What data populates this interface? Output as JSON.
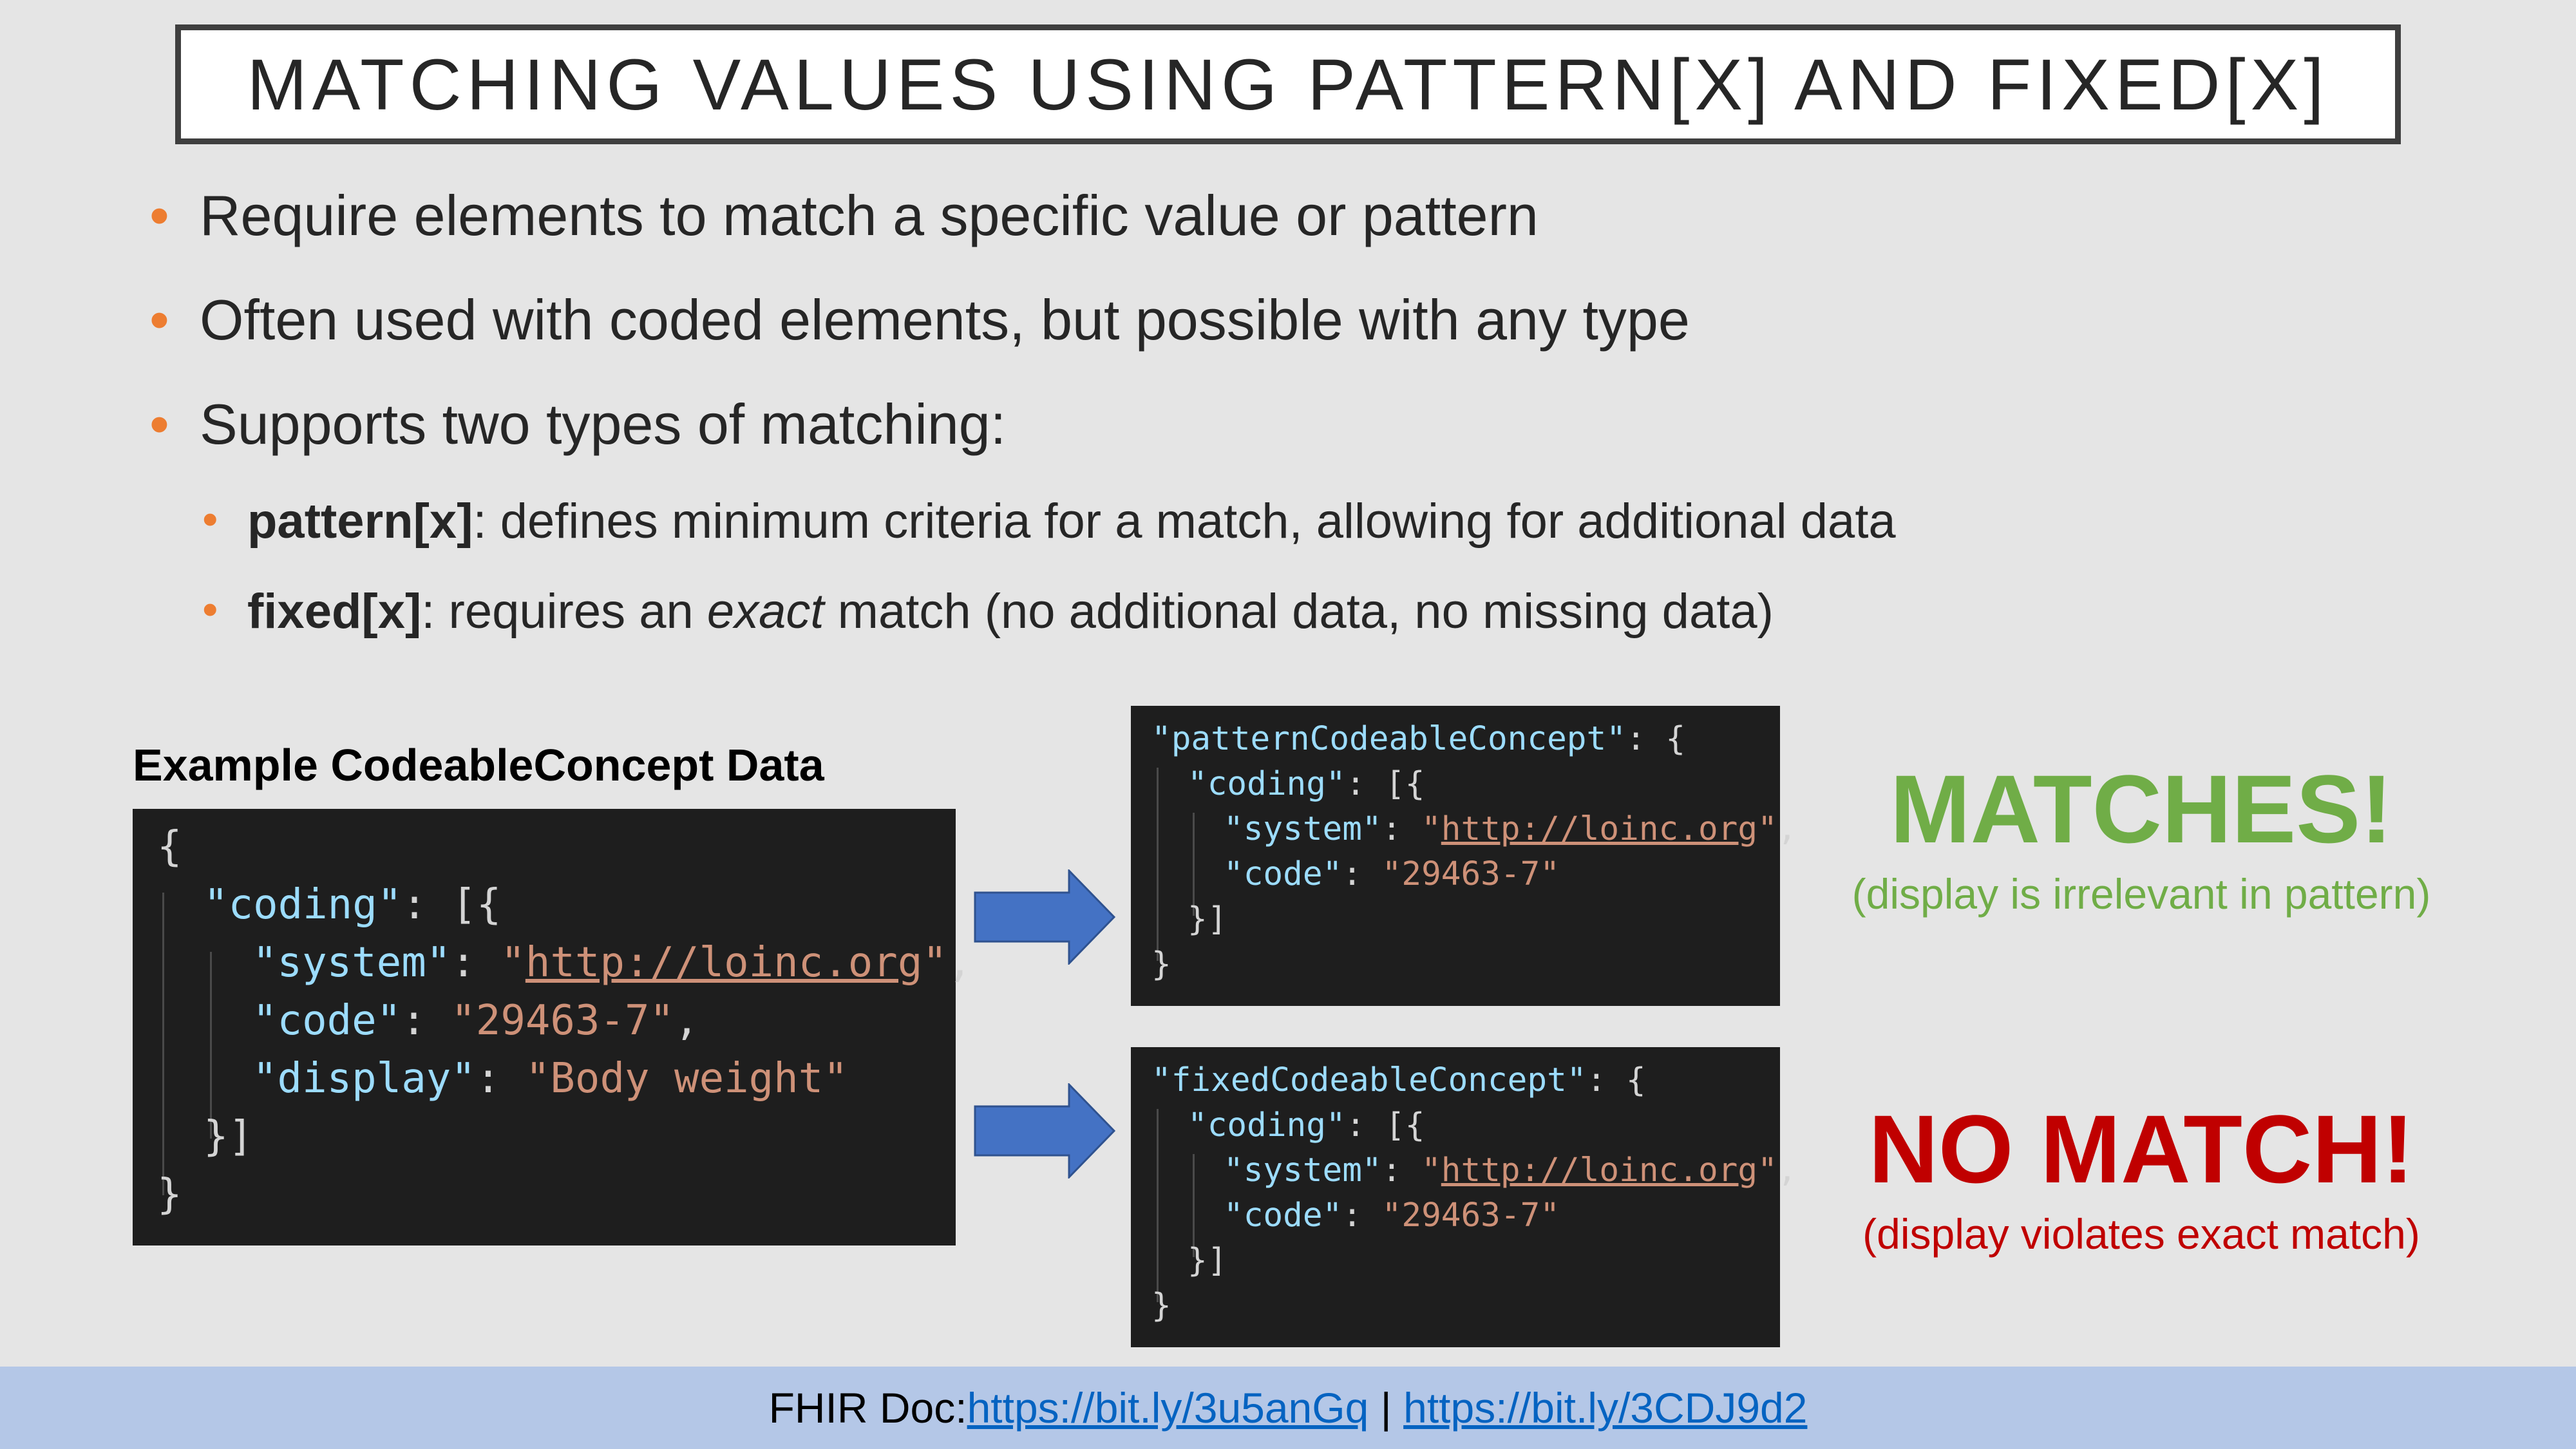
{
  "title": "MATCHING VALUES USING PATTERN[X] AND FIXED[X]",
  "bullets": {
    "b1": "Require elements to match a specific value or pattern",
    "b2": "Often used with coded elements, but possible with any type",
    "b3": "Supports two types of matching:",
    "pattern_term": "pattern[x]",
    "pattern_desc": ": defines minimum criteria for a match, allowing for additional data",
    "fixed_term": "fixed[x]",
    "fixed_desc_pre": ": requires an ",
    "fixed_desc_em": "exact",
    "fixed_desc_post": " match (no additional data, no missing data)"
  },
  "example": {
    "label": "Example CodeableConcept Data",
    "open": "{",
    "coding_key": "\"coding\"",
    "coding_open": ": [{",
    "system_key": "\"system\"",
    "colon": ": ",
    "system_q1": "\"",
    "system_url": "http://loinc.org",
    "system_q2": "\"",
    "comma": ",",
    "code_key": "\"code\"",
    "code_val": "\"29463-7\"",
    "display_key": "\"display\"",
    "display_val": "\"Body weight\"",
    "close_arr": "}]",
    "close": "}"
  },
  "pattern_block": {
    "key": "\"patternCodeableConcept\"",
    "open": ": {",
    "coding_key": "\"coding\"",
    "coding_open": ": [{",
    "system_key": "\"system\"",
    "colon": ": ",
    "q": "\"",
    "system_url": "http://loinc.org",
    "comma": ",",
    "code_key": "\"code\"",
    "code_val": "\"29463-7\"",
    "close_arr": "}]",
    "close": "}"
  },
  "fixed_block": {
    "key": "\"fixedCodeableConcept\"",
    "open": ": {",
    "coding_key": "\"coding\"",
    "coding_open": ": [{",
    "system_key": "\"system\"",
    "colon": ": ",
    "q": "\"",
    "system_url": "http://loinc.org",
    "comma": ",",
    "code_key": "\"code\"",
    "code_val": "\"29463-7\"",
    "close_arr": "}]",
    "close": "}"
  },
  "results": {
    "match_title": "MATCHES!",
    "match_note": "(display is irrelevant in pattern)",
    "nomatch_title": "NO MATCH!",
    "nomatch_note": "(display violates exact match)"
  },
  "footer": {
    "prefix": "FHIR Doc: ",
    "link1": "https://bit.ly/3u5anGq",
    "sep": " | ",
    "link2": "https://bit.ly/3CDJ9d2"
  },
  "colors": {
    "bullet": "#ed7d31",
    "match": "#70ad47",
    "nomatch": "#c00000",
    "arrow": "#4472c4",
    "footer_bg": "#b4c7e7"
  }
}
